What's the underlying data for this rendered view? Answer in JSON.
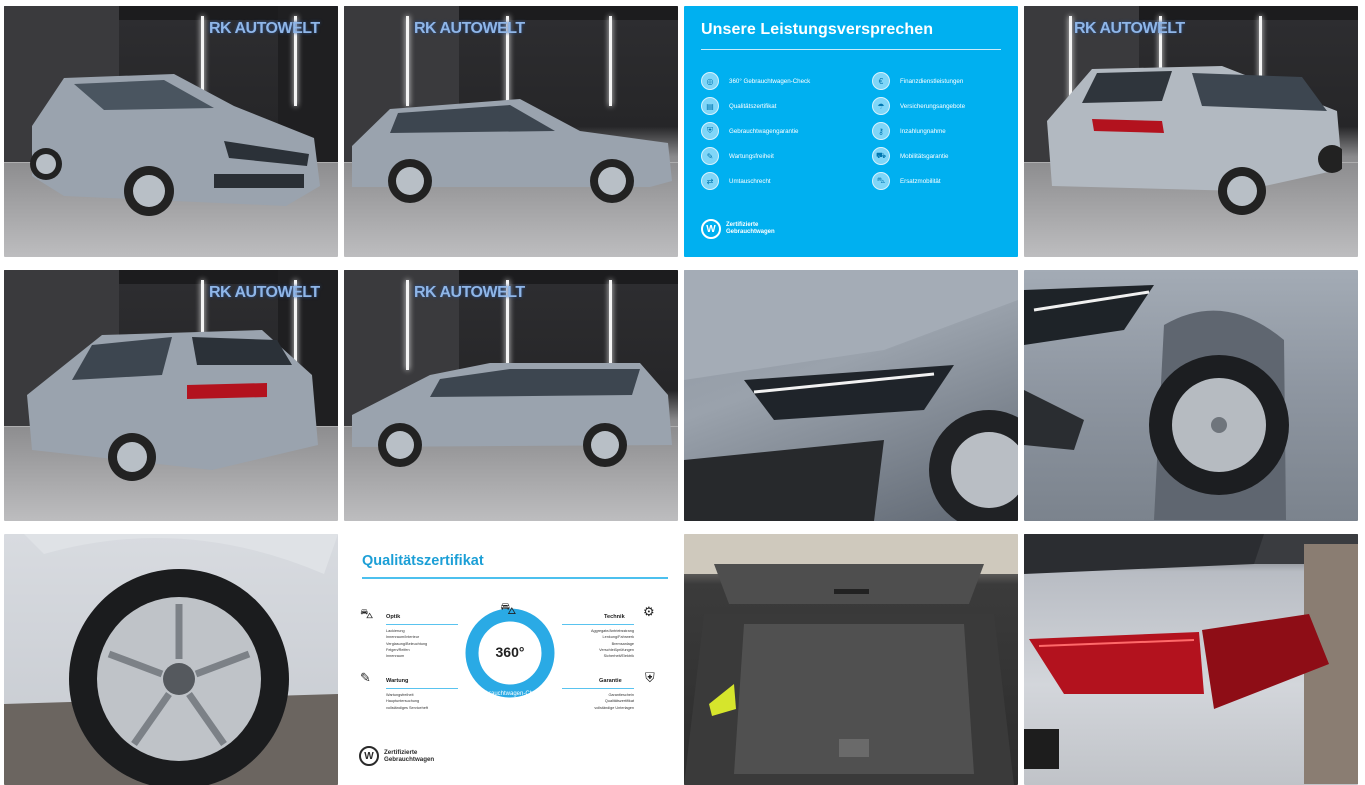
{
  "gallery": {
    "dealer_logo_text": "RK AUTOWELT",
    "promise_panel": {
      "title": "Unsere Leistungsversprechen",
      "items_left": [
        {
          "label": "360° Gebrauchtwagen-Check",
          "icon": "car-check-icon"
        },
        {
          "label": "Qualitätszertifikat",
          "icon": "certificate-icon"
        },
        {
          "label": "Gebrauchtwagengarantie",
          "icon": "shield-icon"
        },
        {
          "label": "Wartungsfreiheit",
          "icon": "wrench-icon"
        },
        {
          "label": "Umtauschrecht",
          "icon": "exchange-icon"
        }
      ],
      "items_right": [
        {
          "label": "Finanzdienstleistungen",
          "icon": "money-icon"
        },
        {
          "label": "Versicherungsangebote",
          "icon": "umbrella-icon"
        },
        {
          "label": "Inzahlungnahme",
          "icon": "key-icon"
        },
        {
          "label": "Mobilitätsgarantie",
          "icon": "tow-icon"
        },
        {
          "label": "Ersatzmobilität",
          "icon": "car-icon"
        }
      ],
      "badge_line1": "Zertifizierte",
      "badge_line2": "Gebrauchtwagen"
    },
    "quality_panel": {
      "title": "Qualitätszertifikat",
      "ring_number": "360°",
      "ring_caption": "Gebrauchtwagen-Check",
      "sections": {
        "optik": {
          "title": "Optik",
          "items": [
            "Lackierung",
            "Innenraum/Interieur",
            "Verglasung/Beleuchtung",
            "Felgen/Reifen",
            "Innenraum"
          ]
        },
        "technik": {
          "title": "Technik",
          "items": [
            "Aggregate/Antriebsstrang",
            "Lenkung/Fahrwerk",
            "Bremsanlage",
            "Verschleißprüfungen",
            "Sicherheit/Elektrik"
          ]
        },
        "wartung": {
          "title": "Wartung",
          "items": [
            "Wartungsfreiheit",
            "Hauptuntersuchung",
            "vollständiges Serviceheft"
          ]
        },
        "garantie": {
          "title": "Garantie",
          "items": [
            "Garantieschein",
            "Qualitätszertifikat",
            "vollständige Unterlagen"
          ]
        }
      },
      "badge_line1": "Zertifizierte",
      "badge_line2": "Gebrauchtwagen"
    },
    "colors": {
      "vw_blue": "#00b0f0",
      "quality_blue": "#1c9fd6",
      "car_grey": "#9aa3ae",
      "taillight_red": "#b3121e"
    }
  }
}
